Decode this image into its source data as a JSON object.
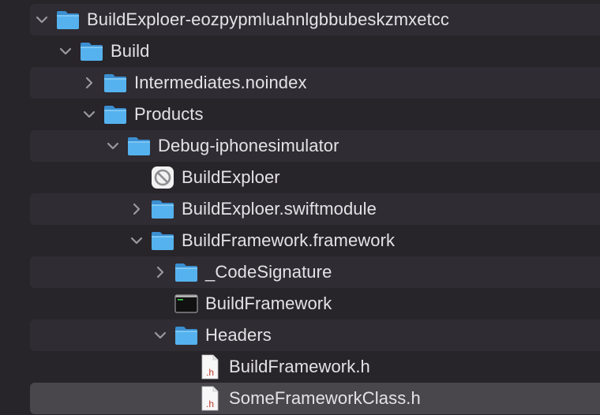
{
  "tree": {
    "items": [
      {
        "label": "BuildExploer-eozpypmluahnlgbbubeskzmxetcc",
        "kind": "folder",
        "disclosure": "expanded",
        "depth": 0,
        "icon": "folder-icon"
      },
      {
        "label": "Build",
        "kind": "folder",
        "disclosure": "expanded",
        "depth": 1,
        "icon": "folder-icon"
      },
      {
        "label": "Intermediates.noindex",
        "kind": "folder",
        "disclosure": "collapsed",
        "depth": 2,
        "icon": "folder-icon"
      },
      {
        "label": "Products",
        "kind": "folder",
        "disclosure": "expanded",
        "depth": 2,
        "icon": "folder-icon"
      },
      {
        "label": "Debug-iphonesimulator",
        "kind": "folder",
        "disclosure": "expanded",
        "depth": 3,
        "icon": "folder-icon"
      },
      {
        "label": "BuildExploer",
        "kind": "app",
        "disclosure": "none",
        "depth": 4,
        "icon": "prohibited-app-icon"
      },
      {
        "label": "BuildExploer.swiftmodule",
        "kind": "folder",
        "disclosure": "collapsed",
        "depth": 4,
        "icon": "folder-icon"
      },
      {
        "label": "BuildFramework.framework",
        "kind": "folder",
        "disclosure": "expanded",
        "depth": 4,
        "icon": "folder-icon"
      },
      {
        "label": "_CodeSignature",
        "kind": "folder",
        "disclosure": "collapsed",
        "depth": 5,
        "icon": "folder-icon"
      },
      {
        "label": "BuildFramework",
        "kind": "exec",
        "disclosure": "none",
        "depth": 5,
        "icon": "terminal-executable-icon"
      },
      {
        "label": "Headers",
        "kind": "folder",
        "disclosure": "expanded",
        "depth": 5,
        "icon": "folder-icon"
      },
      {
        "label": "BuildFramework.h",
        "kind": "header",
        "disclosure": "none",
        "depth": 6,
        "icon": "header-file-icon"
      },
      {
        "label": "SomeFrameworkClass.h",
        "kind": "header",
        "disclosure": "none",
        "depth": 6,
        "icon": "header-file-icon",
        "selected": true
      }
    ]
  },
  "colors": {
    "background": "#27242a",
    "stripe": "#2f2c33",
    "selection": "#49474c",
    "folder": "#4aa7e8",
    "text": "#e4e2e6"
  },
  "icon_text": {
    "header_letter": "h"
  }
}
